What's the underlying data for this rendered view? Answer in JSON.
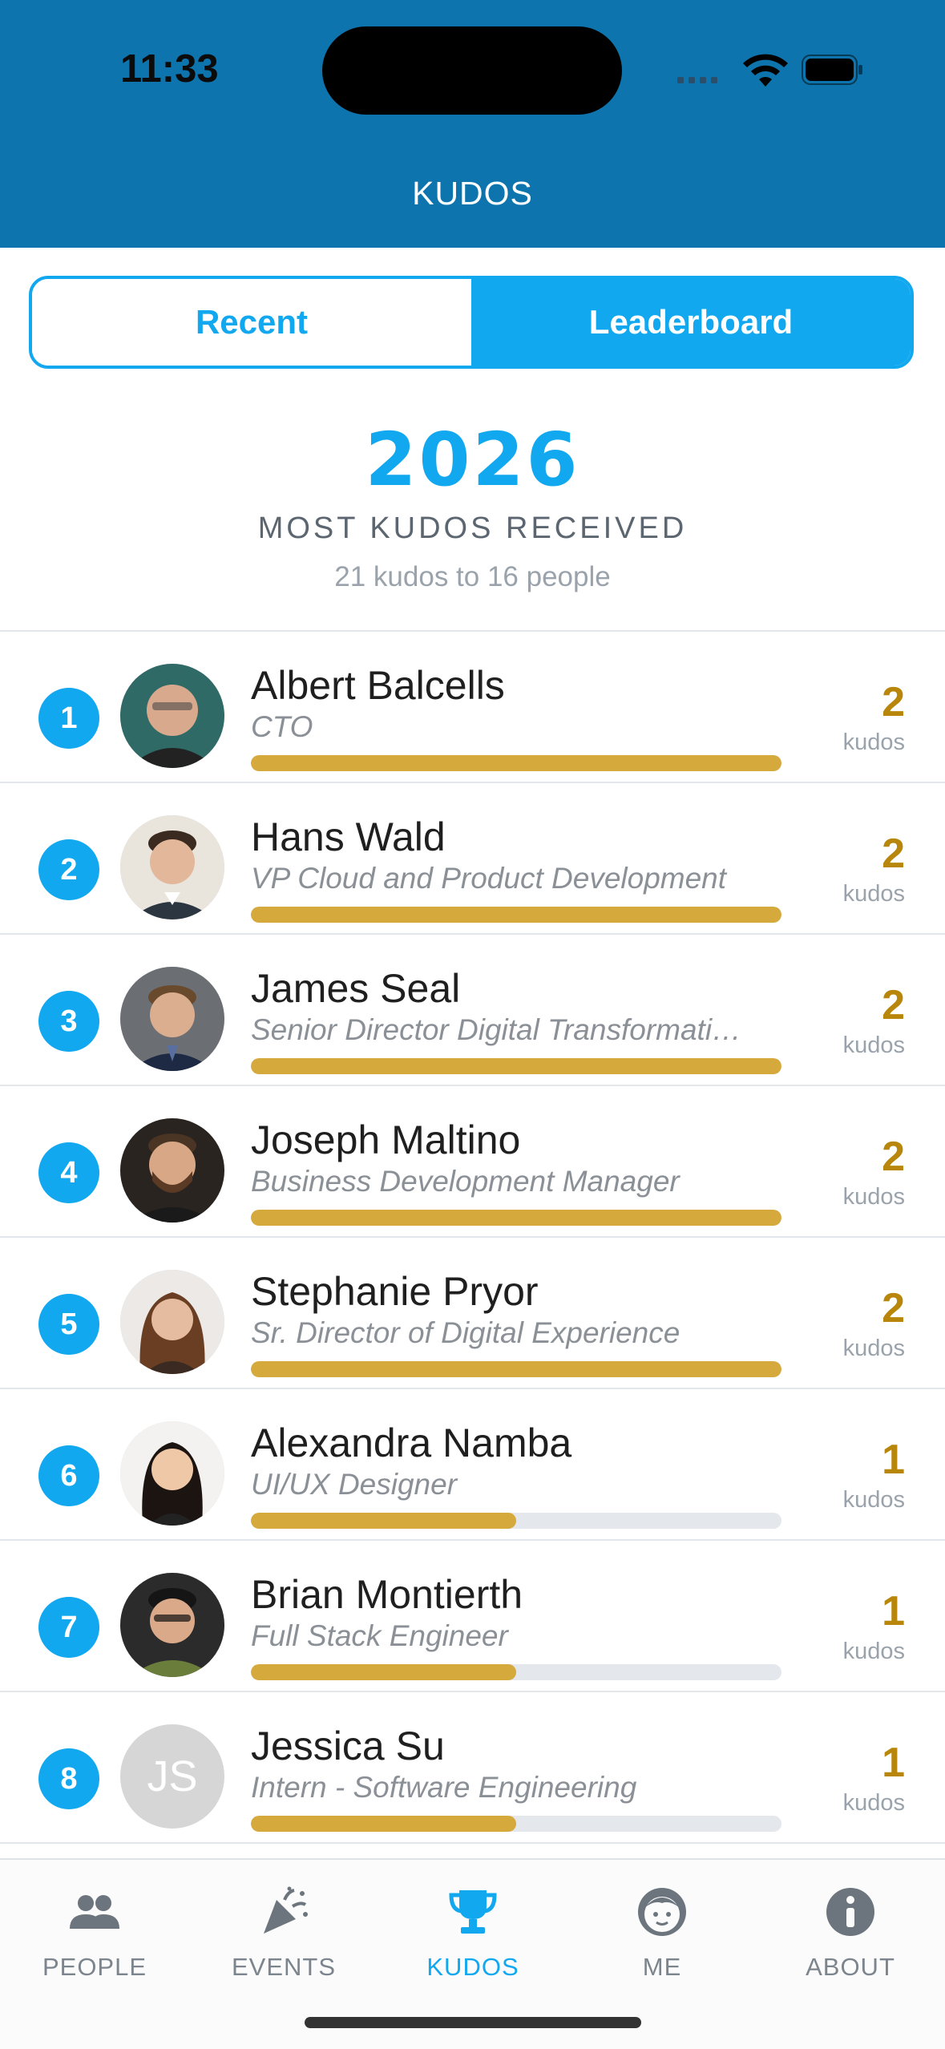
{
  "status_bar": {
    "time": "11:33"
  },
  "header": {
    "title": "KUDOS"
  },
  "segmented": {
    "recent": "Recent",
    "leaderboard": "Leaderboard",
    "selected": "Leaderboard"
  },
  "summary": {
    "year": "2026",
    "subtitle": "MOST KUDOS RECEIVED",
    "count_text": "21 kudos to 16 people"
  },
  "leaderboard": [
    {
      "rank": "1",
      "name": "Albert Balcells",
      "title": "CTO",
      "kudos": "2",
      "kudos_label": "kudos",
      "bar_fraction": 1.0
    },
    {
      "rank": "2",
      "name": "Hans Wald",
      "title": "VP Cloud and Product Development",
      "kudos": "2",
      "kudos_label": "kudos",
      "bar_fraction": 1.0
    },
    {
      "rank": "3",
      "name": "James Seal",
      "title": "Senior Director Digital Transformati…",
      "kudos": "2",
      "kudos_label": "kudos",
      "bar_fraction": 1.0
    },
    {
      "rank": "4",
      "name": "Joseph Maltino",
      "title": "Business Development Manager",
      "kudos": "2",
      "kudos_label": "kudos",
      "bar_fraction": 1.0
    },
    {
      "rank": "5",
      "name": "Stephanie Pryor",
      "title": "Sr. Director of Digital Experience",
      "kudos": "2",
      "kudos_label": "kudos",
      "bar_fraction": 1.0
    },
    {
      "rank": "6",
      "name": "Alexandra Namba",
      "title": "UI/UX Designer",
      "kudos": "1",
      "kudos_label": "kudos",
      "bar_fraction": 0.5
    },
    {
      "rank": "7",
      "name": "Brian Montierth",
      "title": "Full Stack Engineer",
      "kudos": "1",
      "kudos_label": "kudos",
      "bar_fraction": 0.5
    },
    {
      "rank": "8",
      "name": "Jessica Su",
      "title": "Intern - Software Engineering",
      "kudos": "1",
      "kudos_label": "kudos",
      "bar_fraction": 0.5,
      "initials": "JS"
    }
  ],
  "tabs": [
    {
      "label": "PEOPLE",
      "icon": "people-icon",
      "active": false
    },
    {
      "label": "EVENTS",
      "icon": "party-popper-icon",
      "active": false
    },
    {
      "label": "KUDOS",
      "icon": "trophy-icon",
      "active": true
    },
    {
      "label": "ME",
      "icon": "face-icon",
      "active": false
    },
    {
      "label": "ABOUT",
      "icon": "info-icon",
      "active": false
    }
  ],
  "colors": {
    "header": "#0d74ad",
    "accent": "#11a8ef",
    "gold": "#d6a93c",
    "kudos_count": "#b8860b"
  }
}
